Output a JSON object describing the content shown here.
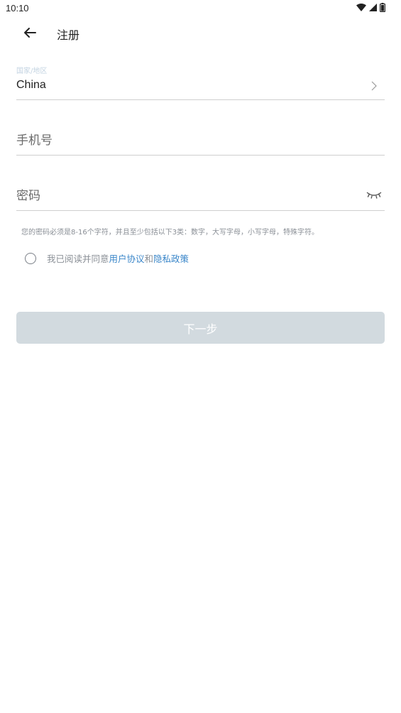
{
  "status_bar": {
    "time": "10:10",
    "icons": [
      "wifi-icon",
      "signal-icon",
      "battery-icon"
    ]
  },
  "app_bar": {
    "back_icon": "arrow-left-icon",
    "title": "注册"
  },
  "region_field": {
    "label": "国家/地区",
    "value": "China",
    "icon": "chevron-right-icon"
  },
  "phone_field": {
    "placeholder": "手机号"
  },
  "password_field": {
    "placeholder": "密码",
    "icon": "eye-off-icon"
  },
  "hint": "您的密码必须是8-16个字符，并且至少包括以下3类：数字，大写字母，小写字母，特殊字符。",
  "agreement": {
    "checked": false,
    "prefix": "我已阅读并同意",
    "user_agreement": "用户协议",
    "conjunction": "和",
    "privacy_policy": "隐私政策"
  },
  "next_button": {
    "label": "下一步",
    "enabled": false
  },
  "colors": {
    "link": "#3a86c9",
    "button_disabled": "#d2dadf",
    "label_small": "#c3d3e1",
    "hint": "#8a8f96"
  }
}
